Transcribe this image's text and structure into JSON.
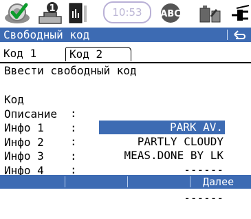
{
  "status": {
    "time": "10:53",
    "icons": [
      "gps-satellite-icon",
      "survey-instrument-icon",
      "level-bubble-icon",
      "clock-icon",
      "abc-input-mode-icon",
      "battery-icon",
      "power-plug-icon"
    ]
  },
  "title": {
    "text": "Свободный код"
  },
  "tabs": [
    {
      "label": "Код 1"
    },
    {
      "label": "Код 2"
    }
  ],
  "form": {
    "heading": "Ввести свободный код",
    "rows": [
      {
        "label": "Код",
        "value": "PARK AV."
      },
      {
        "label": "Описание",
        "value": "PARTLY CLOUDY"
      },
      {
        "label": "Инфо 1",
        "value": "MEAS.DONE BY LK"
      },
      {
        "label": "Инфо 2",
        "value": "------"
      },
      {
        "label": "Инфо 3",
        "value": "------"
      },
      {
        "label": "Инфо 4",
        "value": "------"
      }
    ]
  },
  "softkeys": {
    "next_label": "Далее"
  },
  "colors": {
    "accent": "#3d6bb3",
    "clock_ring": "#b9b0d6"
  }
}
